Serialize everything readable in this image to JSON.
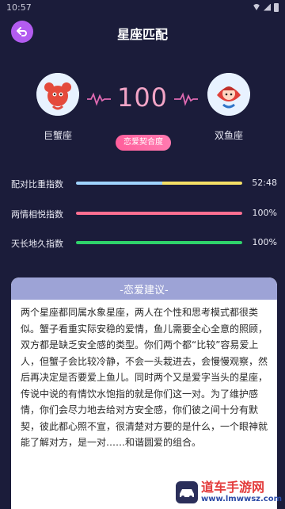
{
  "status_bar": {
    "time": "10:57"
  },
  "header": {
    "title": "星座匹配"
  },
  "match": {
    "left_sign": "巨蟹座",
    "right_sign": "双鱼座",
    "score": "100",
    "chip_label": "恋爱契合度"
  },
  "metrics": [
    {
      "label": "配对比重指数",
      "value": "52:48",
      "fill": 1.0,
      "colors": [
        "#9fd3ff",
        "#f5df66"
      ]
    },
    {
      "label": "两情相悦指数",
      "value": "100%",
      "fill": 1.0,
      "colors": [
        "#ff6f91",
        "#ff6f91"
      ]
    },
    {
      "label": "天长地久指数",
      "value": "100%",
      "fill": 1.0,
      "colors": [
        "#2fd36a",
        "#2fd36a"
      ]
    }
  ],
  "advice": {
    "title": "-恋爱建议-",
    "text": "两个星座都同属水象星座，两人在个性和思考模式都很类似。蟹子看重实际安稳的爱情，鱼儿需要全心全意的照顾，双方都是缺乏安全感的类型。你们两个都“比较”容易爱上人，但蟹子会比较冷静，不会一头栽进去，会慢慢观察，然后再决定是否要爱上鱼儿。同时两个又是爱字当头的星座，传说中说的有情饮水饱指的就是你们这一对。为了维护感情，你们会尽力地去给对方安全感，你们彼之间十分有默契，彼此都心照不宣，很清楚对方要的是什么，一个眼神就能了解对方，是一对……和谐圆爱的组合。"
  },
  "watermark": {
    "main": "道车手游网",
    "sub": "www.lmwwsz.com"
  },
  "colors": {
    "background": "#1b1c3a",
    "accent": "#b35cf0",
    "score": "#f2a4c6",
    "chip": "#ff5e9b",
    "card_head": "#9da3d6"
  },
  "icons": {
    "back": "back-arrow-icon",
    "left_sign_icon": "cancer-avatar-icon",
    "right_sign_icon": "pisces-avatar-icon"
  }
}
